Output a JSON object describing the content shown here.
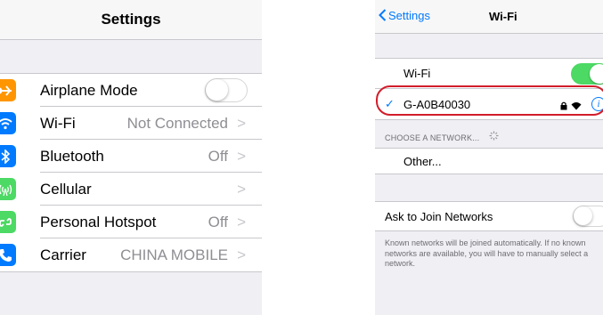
{
  "left": {
    "title": "Settings",
    "rows": [
      {
        "label": "Airplane Mode",
        "value": "",
        "icon": "airplane-icon",
        "color": "#ff9500",
        "glyph": "✈"
      },
      {
        "label": "Wi-Fi",
        "value": "Not Connected",
        "icon": "wifi-icon",
        "color": "#007aff",
        "glyph": "◠"
      },
      {
        "label": "Bluetooth",
        "value": "Off",
        "icon": "bluetooth-icon",
        "color": "#007aff",
        "glyph": "ᛒ"
      },
      {
        "label": "Cellular",
        "value": "",
        "icon": "cellular-icon",
        "color": "#4cd964",
        "glyph": "((·))"
      },
      {
        "label": "Personal Hotspot",
        "value": "Off",
        "icon": "hotspot-icon",
        "color": "#4cd964",
        "glyph": "∞"
      },
      {
        "label": "Carrier",
        "value": "CHINA MOBILE",
        "icon": "phone-icon",
        "color": "#4cd964",
        "glyph": "✆"
      }
    ],
    "airplane_mode_on": false
  },
  "right": {
    "back_label": "Settings",
    "title": "Wi-Fi",
    "wifi_label": "Wi-Fi",
    "wifi_on": true,
    "network_name": "G-A0B40030",
    "section_header": "CHOOSE A NETWORK...",
    "other_label": "Other...",
    "ask_label": "Ask to Join Networks",
    "ask_on": false,
    "footer_line1": "Known networks will be joined automatically. If no known",
    "footer_line2": "networks are available, you will have to manually select a",
    "footer_line3": "network."
  },
  "colors": {
    "accent": "#007aff",
    "toggle_on": "#4cd964",
    "highlight": "#d21d2a"
  }
}
